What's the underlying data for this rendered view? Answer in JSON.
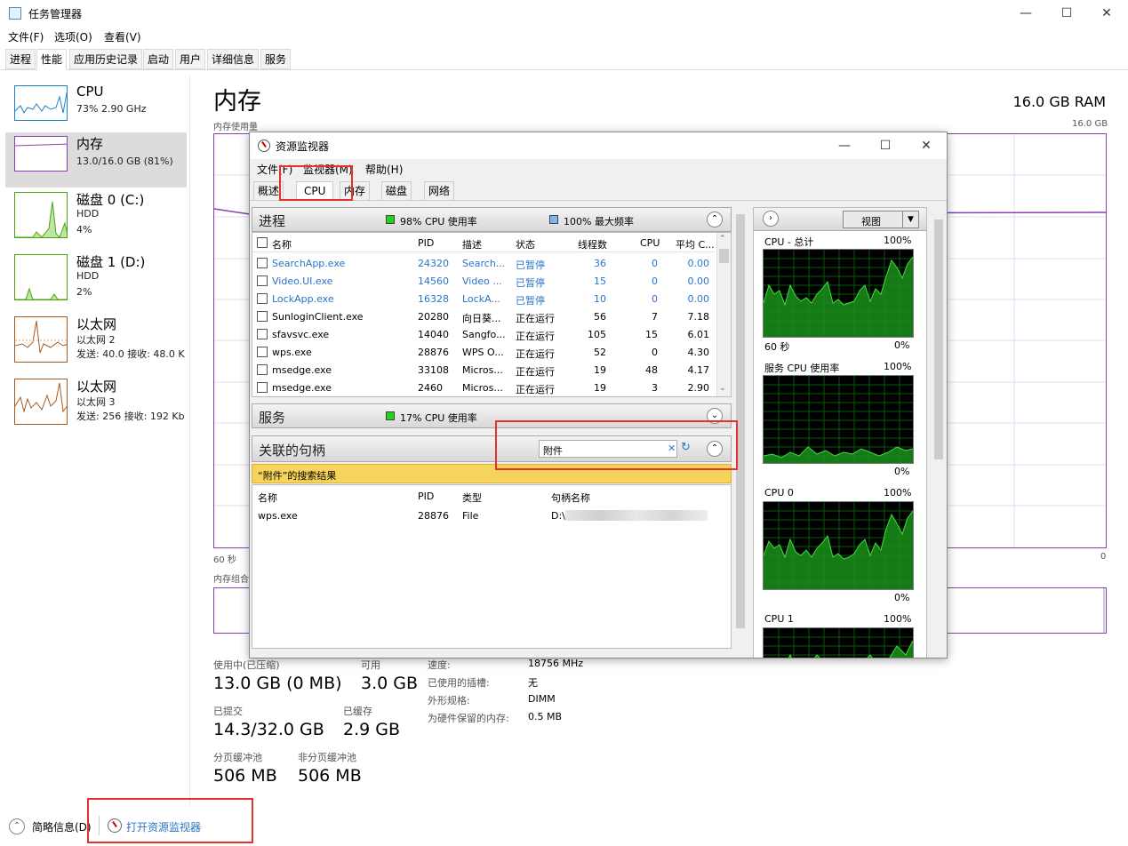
{
  "task_manager": {
    "title": "任务管理器",
    "menu": [
      "文件(F)",
      "选项(O)",
      "查看(V)"
    ],
    "tabs": [
      "进程",
      "性能",
      "应用历史记录",
      "启动",
      "用户",
      "详细信息",
      "服务"
    ],
    "left_items": [
      {
        "name": "CPU",
        "line1": "73% 2.90 GHz",
        "line2": ""
      },
      {
        "name": "内存",
        "line1": "13.0/16.0 GB (81%)",
        "line2": ""
      },
      {
        "name": "磁盘 0 (C:)",
        "line1": "HDD",
        "line2": "4%"
      },
      {
        "name": "磁盘 1 (D:)",
        "line1": "HDD",
        "line2": "2%"
      },
      {
        "name": "以太网",
        "line1": "以太网 2",
        "line2": "发送: 40.0  接收: 48.0 K"
      },
      {
        "name": "以太网",
        "line1": "以太网 3",
        "line2": "发送: 256  接收: 192 Kb"
      }
    ],
    "memory": {
      "title": "内存",
      "ram": "16.0 GB RAM",
      "usage_label": "内存使用量",
      "max_label": "16.0 GB",
      "time_label": "60 秒",
      "zero_label": "0",
      "composition_label": "内存组合",
      "stats": [
        {
          "label": "使用中(已压缩)",
          "value": "13.0 GB (0 MB)"
        },
        {
          "label": "可用",
          "value": "3.0 GB"
        },
        {
          "label": "已提交",
          "value": "14.3/32.0 GB"
        },
        {
          "label": "已缓存",
          "value": "2.9 GB"
        },
        {
          "label": "分页缓冲池",
          "value": "506 MB"
        },
        {
          "label": "非分页缓冲池",
          "value": "506 MB"
        }
      ],
      "details": [
        {
          "label": "速度:",
          "value": "18756 MHz"
        },
        {
          "label": "已使用的插槽:",
          "value": "无"
        },
        {
          "label": "外形规格:",
          "value": "DIMM"
        },
        {
          "label": "为硬件保留的内存:",
          "value": "0.5 MB"
        }
      ]
    },
    "footer": {
      "brief": "简略信息(D)",
      "open_monitor": "打开资源监视器"
    }
  },
  "resource_monitor": {
    "title": "资源监视器",
    "menu": [
      "文件(F)",
      "监视器(M)",
      "帮助(H)"
    ],
    "tabs": [
      "概述",
      "CPU",
      "内存",
      "磁盘",
      "网络"
    ],
    "processes": {
      "title": "进程",
      "legend1": "98% CPU 使用率",
      "legend2": "100% 最大频率",
      "columns": [
        "名称",
        "PID",
        "描述",
        "状态",
        "线程数",
        "CPU",
        "平均 C..."
      ],
      "rows": [
        {
          "name": "SearchApp.exe",
          "pid": "24320",
          "desc": "Search...",
          "status": "已暂停",
          "threads": "36",
          "cpu": "0",
          "avg": "0.00",
          "suspended": true
        },
        {
          "name": "Video.UI.exe",
          "pid": "14560",
          "desc": "Video ...",
          "status": "已暂停",
          "threads": "15",
          "cpu": "0",
          "avg": "0.00",
          "suspended": true
        },
        {
          "name": "LockApp.exe",
          "pid": "16328",
          "desc": "LockA...",
          "status": "已暂停",
          "threads": "10",
          "cpu": "0",
          "avg": "0.00",
          "suspended": true
        },
        {
          "name": "SunloginClient.exe",
          "pid": "20280",
          "desc": "向日葵...",
          "status": "正在运行",
          "threads": "56",
          "cpu": "7",
          "avg": "7.18",
          "suspended": false
        },
        {
          "name": "sfavsvc.exe",
          "pid": "14040",
          "desc": "Sangfo...",
          "status": "正在运行",
          "threads": "105",
          "cpu": "15",
          "avg": "6.01",
          "suspended": false
        },
        {
          "name": "wps.exe",
          "pid": "28876",
          "desc": "WPS O...",
          "status": "正在运行",
          "threads": "52",
          "cpu": "0",
          "avg": "4.30",
          "suspended": false
        },
        {
          "name": "msedge.exe",
          "pid": "33108",
          "desc": "Micros...",
          "status": "正在运行",
          "threads": "19",
          "cpu": "48",
          "avg": "4.17",
          "suspended": false
        },
        {
          "name": "msedge.exe",
          "pid": "2460",
          "desc": "Micros...",
          "status": "正在运行",
          "threads": "19",
          "cpu": "3",
          "avg": "2.90",
          "suspended": false
        }
      ]
    },
    "services": {
      "title": "服务",
      "legend": "17% CPU 使用率"
    },
    "handles": {
      "title": "关联的句柄",
      "search_value": "附件",
      "result_banner": "“附件”的搜索结果",
      "columns": [
        "名称",
        "PID",
        "类型",
        "句柄名称"
      ],
      "rows": [
        {
          "name": "wps.exe",
          "pid": "28876",
          "type": "File",
          "handle": "D:\\"
        }
      ]
    },
    "right": {
      "view_label": "视图",
      "graphs": [
        {
          "title": "CPU - 总计",
          "max": "100%",
          "left_bottom": "60 秒",
          "right_bottom": "0%"
        },
        {
          "title": "服务 CPU 使用率",
          "max": "100%",
          "left_bottom": "",
          "right_bottom": "0%"
        },
        {
          "title": "CPU 0",
          "max": "100%",
          "left_bottom": "",
          "right_bottom": "0%"
        },
        {
          "title": "CPU 1",
          "max": "100%",
          "left_bottom": "",
          "right_bottom": ""
        }
      ]
    }
  },
  "colors": {
    "accent": "#2a75c7",
    "memory": "#8b3fb3",
    "highlight": "#e53030",
    "banner": "#f6d35a",
    "graph_green": "#22b422"
  }
}
